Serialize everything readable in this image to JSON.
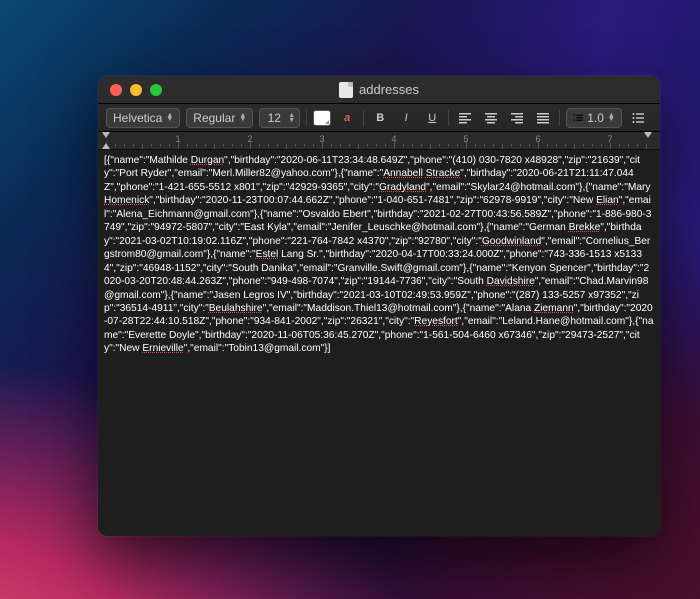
{
  "window": {
    "title": "addresses"
  },
  "toolbar": {
    "font_family": "Helvetica",
    "font_style": "Regular",
    "font_size": "12",
    "letter_a": "a",
    "bold": "B",
    "italic": "I",
    "underline": "U",
    "line_spacing": "1.0"
  },
  "ruler": {
    "labels": [
      "1",
      "2",
      "3",
      "4",
      "5",
      "6",
      "7"
    ]
  },
  "content": {
    "raw": "[{\"name\":\"Mathilde Durgan\",\"birthday\":\"2020-06-11T23:34:48.649Z\",\"phone\":\"(410) 030-7820 x48928\",\"zip\":\"21639\",\"city\":\"Port Ryder\",\"email\":\"Merl.Miller82@yahoo.com\"},{\"name\":\"Annabell Stracke\",\"birthday\":\"2020-06-21T21:11:47.044Z\",\"phone\":\"1-421-655-5512 x801\",\"zip\":\"42929-9365\",\"city\":\"Gradyland\",\"email\":\"Skylar24@hotmail.com\"},{\"name\":\"Mary Homenick\",\"birthday\":\"2020-11-23T00:07:44.662Z\",\"phone\":\"1-040-651-7481\",\"zip\":\"62978-9919\",\"city\":\"New Elian\",\"email\":\"Alena_Eichmann@gmail.com\"},{\"name\":\"Osvaldo Ebert\",\"birthday\":\"2021-02-27T00:43:56.589Z\",\"phone\":\"1-886-980-3749\",\"zip\":\"94972-5807\",\"city\":\"East Kyla\",\"email\":\"Jenifer_Leuschke@hotmail.com\"},{\"name\":\"German Brekke\",\"birthday\":\"2021-03-02T10:19:02.116Z\",\"phone\":\"221-764-7842 x4370\",\"zip\":\"92780\",\"city\":\"Goodwinland\",\"email\":\"Cornelius_Bergstrom80@gmail.com\"},{\"name\":\"Estel Lang Sr.\",\"birthday\":\"2020-04-17T00:33:24.000Z\",\"phone\":\"743-336-1513 x51334\",\"zip\":\"46948-1152\",\"city\":\"South Danika\",\"email\":\"Granville.Swift@gmail.com\"},{\"name\":\"Kenyon Spencer\",\"birthday\":\"2020-03-20T20:48:44.263Z\",\"phone\":\"949-498-7074\",\"zip\":\"19144-7736\",\"city\":\"South Davidshire\",\"email\":\"Chad.Marvin98@gmail.com\"},{\"name\":\"Jasen Legros IV\",\"birthday\":\"2021-03-10T02:49:53.959Z\",\"phone\":\"(287) 133-5257 x97352\",\"zip\":\"36514-4911\",\"city\":\"Beulahshire\",\"email\":\"Maddison.Thiel13@hotmail.com\"},{\"name\":\"Alana Ziemann\",\"birthday\":\"2020-07-28T22:44:10.518Z\",\"phone\":\"934-841-2002\",\"zip\":\"26321\",\"city\":\"Reyesfort\",\"email\":\"Leland.Hane@hotmail.com\"},{\"name\":\"Everette Doyle\",\"birthday\":\"2020-11-06T05:36:45.270Z\",\"phone\":\"1-561-504-6460 x67346\",\"zip\":\"29473-2527\",\"city\":\"New Ernieville\",\"email\":\"Tobin13@gmail.com\"}]",
    "spellcheck_words": [
      "Durgan",
      "Annabell",
      "Stracke",
      "Gradyland",
      "Homenick",
      "Elian",
      "Brekke",
      "Goodwinland",
      "Estel",
      "Davidshire",
      "Beulahshire",
      "Ziemann",
      "Reyesfort",
      "Ernieville"
    ]
  }
}
